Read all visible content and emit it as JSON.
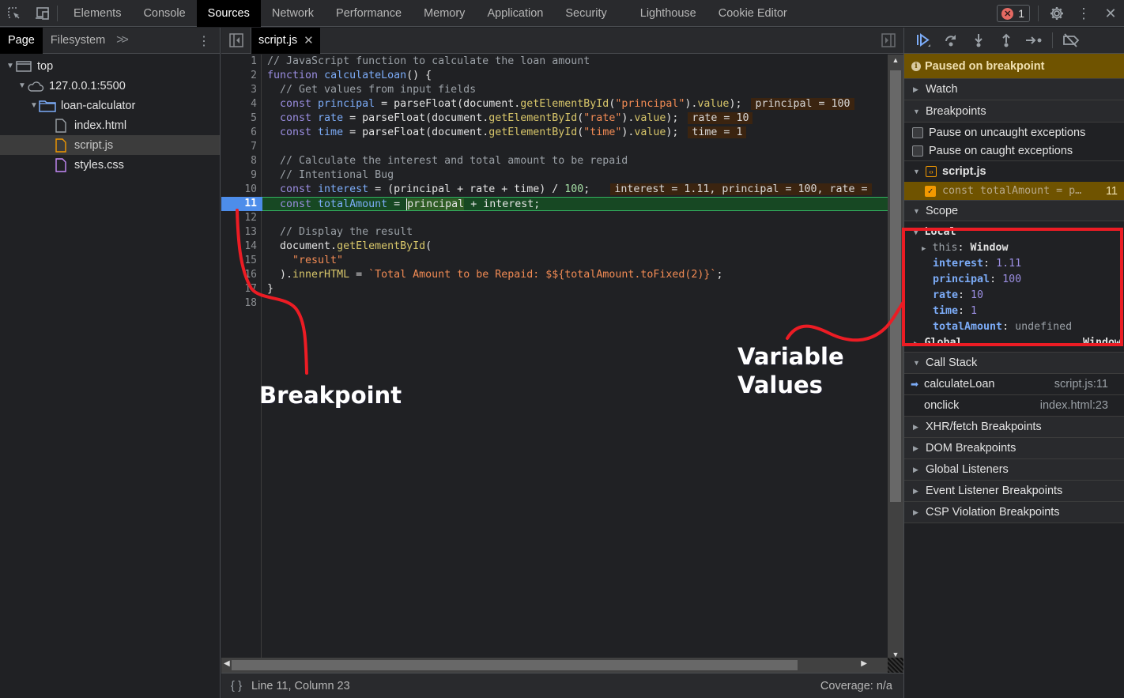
{
  "topbar": {
    "tabs": [
      {
        "label": "Elements",
        "active": false
      },
      {
        "label": "Console",
        "active": false
      },
      {
        "label": "Sources",
        "active": true
      },
      {
        "label": "Network",
        "active": false
      },
      {
        "label": "Performance",
        "active": false
      },
      {
        "label": "Memory",
        "active": false
      },
      {
        "label": "Application",
        "active": false
      },
      {
        "label": "Security",
        "active": false
      },
      {
        "label": "Lighthouse",
        "active": false
      },
      {
        "label": "Cookie Editor",
        "active": false
      }
    ],
    "error_count": "1",
    "icons": [
      "inspect-element-icon",
      "device-toggle-icon",
      "error-icon",
      "settings-gear-icon",
      "kebab-menu-icon",
      "close-icon"
    ]
  },
  "navigator": {
    "tabs": [
      {
        "label": "Page",
        "active": true
      },
      {
        "label": "Filesystem",
        "active": false
      }
    ],
    "more_label": ">>",
    "tree": [
      {
        "label": "top",
        "icon": "frame-icon",
        "level": 0,
        "expanded": true
      },
      {
        "label": "127.0.0.1:5500",
        "icon": "cloud-icon",
        "level": 1,
        "expanded": true
      },
      {
        "label": "loan-calculator",
        "icon": "folder-icon",
        "level": 2,
        "expanded": true
      },
      {
        "label": "index.html",
        "icon": "file-html-icon",
        "level": 3
      },
      {
        "label": "script.js",
        "icon": "file-js-icon",
        "level": 3,
        "selected": true
      },
      {
        "label": "styles.css",
        "icon": "file-css-icon",
        "level": 3
      }
    ]
  },
  "editor": {
    "open_tab": "script.js",
    "breakpoint_line": 11,
    "line_numbers": [
      "1",
      "2",
      "3",
      "4",
      "5",
      "6",
      "7",
      "8",
      "9",
      "10",
      "11",
      "12",
      "13",
      "14",
      "15",
      "16",
      "17",
      "18"
    ],
    "lines": {
      "l1": "// JavaScript function to calculate the loan amount",
      "l2_kw": "function",
      "l2_fn": "calculateLoan",
      "l2_rest": "() {",
      "l3": "  // Get values from input fields",
      "l4": {
        "kw": "  const ",
        "var": "principal",
        "mid": " = parseFloat(document.",
        "fn": "getElementById",
        "p1": "(",
        "str": "\"principal\"",
        "p2": ").",
        "prop": "value",
        "end": ");",
        "inline": "principal = 100"
      },
      "l5": {
        "kw": "  const ",
        "var": "rate",
        "mid": " = parseFloat(document.",
        "fn": "getElementById",
        "p1": "(",
        "str": "\"rate\"",
        "p2": ").",
        "prop": "value",
        "end": ");",
        "inline": "rate = 10"
      },
      "l6": {
        "kw": "  const ",
        "var": "time",
        "mid": " = parseFloat(document.",
        "fn": "getElementById",
        "p1": "(",
        "str": "\"time\"",
        "p2": ").",
        "prop": "value",
        "end": ");",
        "inline": "time = 1"
      },
      "l8": "  // Calculate the interest and total amount to be repaid",
      "l9": "  // Intentional Bug",
      "l10": {
        "kw": "  const ",
        "var": "interest",
        "mid": " = (principal + rate + time) / ",
        "num": "100",
        "end": ";",
        "inline": "interest = 1.11, principal = 100, rate ="
      },
      "l11": {
        "kw": "  const ",
        "var": "totalAmount",
        "mid": " = ",
        "hl": "principal",
        "end": " + interest;"
      },
      "l13": "  // Display the result",
      "l14": {
        "obj": "  document.",
        "fn": "getElementById",
        "end": "("
      },
      "l15": "    \"result\"",
      "l16": {
        "start": "  ).",
        "prop": "innerHTML",
        "mid": " = ",
        "tpl": "`Total Amount to be Repaid: $${totalAmount.toFixed(2)}`",
        "end": ";"
      },
      "l17": "}"
    }
  },
  "statusbar": {
    "position": "Line 11, Column 23",
    "coverage": "Coverage: n/a"
  },
  "debugger": {
    "paused_message": "Paused on breakpoint",
    "sections": {
      "watch": "Watch",
      "breakpoints": "Breakpoints",
      "scope": "Scope",
      "call_stack": "Call Stack",
      "xhr": "XHR/fetch Breakpoints",
      "dom": "DOM Breakpoints",
      "global_listeners": "Global Listeners",
      "event_listeners": "Event Listener Breakpoints",
      "csp": "CSP Violation Breakpoints"
    },
    "pause_uncaught": {
      "label": "Pause on uncaught exceptions",
      "checked": false
    },
    "pause_caught": {
      "label": "Pause on caught exceptions",
      "checked": false
    },
    "bp_file": "script.js",
    "bp_entry": {
      "code": "const totalAmount = p…",
      "line": "11",
      "enabled": true
    },
    "scope": {
      "local_label": "Local",
      "this_key": "this",
      "this_val": "Window",
      "vars": [
        {
          "key": "interest",
          "value": "1.11"
        },
        {
          "key": "principal",
          "value": "100"
        },
        {
          "key": "rate",
          "value": "10"
        },
        {
          "key": "time",
          "value": "1"
        },
        {
          "key": "totalAmount",
          "value": "undefined"
        }
      ],
      "global_label": "Global",
      "global_val": "Window"
    },
    "call_stack": [
      {
        "fn": "calculateLoan",
        "loc": "script.js:11",
        "current": true
      },
      {
        "fn": "onclick",
        "loc": "index.html:23",
        "current": false
      }
    ]
  },
  "annotations": {
    "breakpoint_label": "Breakpoint",
    "variables_label_line1": "Variable",
    "variables_label_line2": "Values",
    "color": "#ec1c24"
  }
}
